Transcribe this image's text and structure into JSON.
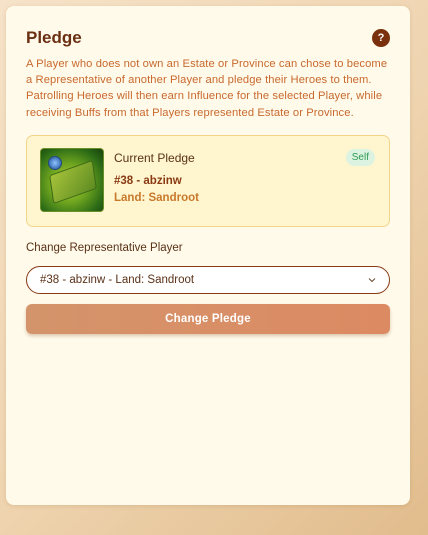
{
  "panel": {
    "title": "Pledge",
    "help_label": "?",
    "description": "A Player who does not own an Estate or Province can chose to become a Representative of another Player and pledge their Heroes to them. Patrolling Heroes will then earn Influence for the selected Player, while receiving Buffs from that Players represented Estate or Province."
  },
  "current_pledge": {
    "label": "Current Pledge",
    "badge": "Self",
    "player": "#38 - abzinw",
    "land": "Land: Sandroot",
    "thumbnail_icon": "land-tile-icon"
  },
  "representative": {
    "label": "Change Representative Player",
    "selected": "#38 - abzinw - Land: Sandroot"
  },
  "actions": {
    "change_label": "Change Pledge"
  },
  "colors": {
    "title": "#6b2f12",
    "description": "#c8692e",
    "badge_bg": "#dcf3e2",
    "badge_text": "#2f9b53",
    "button": "#d98d66"
  }
}
